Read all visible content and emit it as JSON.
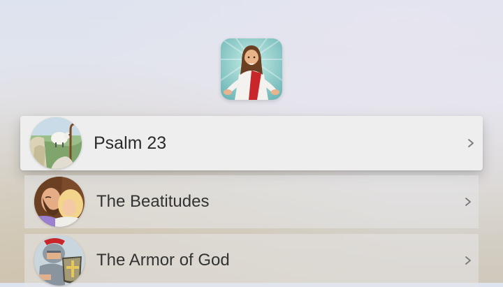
{
  "app": {
    "icon": "jesus-portrait-icon"
  },
  "stories": {
    "items": [
      {
        "title": "Psalm 23",
        "icon": "shepherd-with-lamb-thumbnail",
        "focused": true
      },
      {
        "title": "The Beatitudes",
        "icon": "jesus-embracing-child-thumbnail",
        "focused": false
      },
      {
        "title": "The Armor of God",
        "icon": "armored-soldier-thumbnail",
        "focused": false
      }
    ]
  },
  "colors": {
    "focused_row": "#eeeeef",
    "text": "#2b2b2b",
    "robe_red": "#c8262a",
    "icon_sky": "#7ec3c1"
  }
}
